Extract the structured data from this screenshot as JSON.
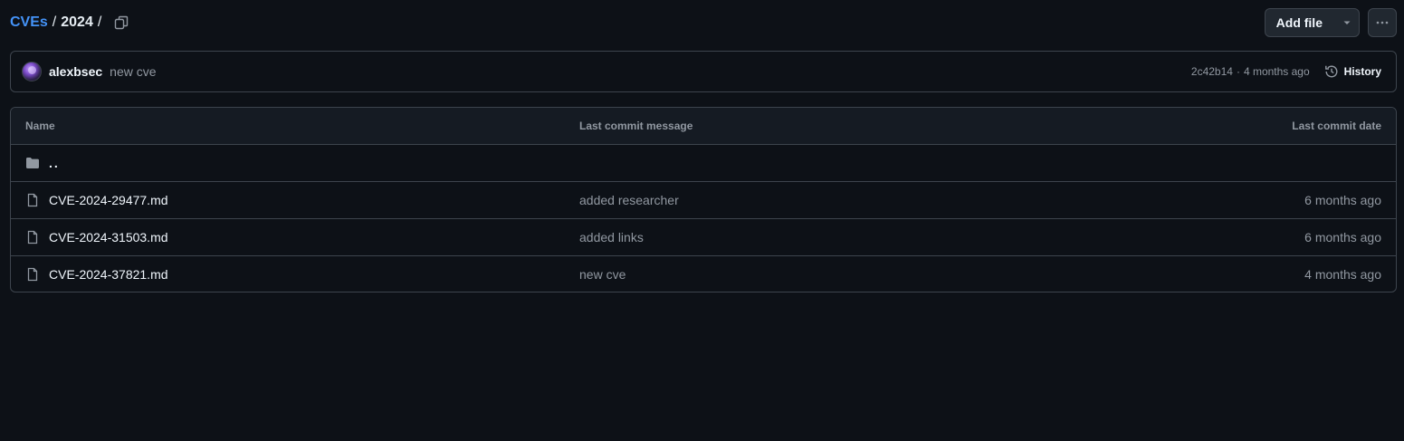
{
  "breadcrumb": {
    "repo": "CVEs",
    "separator": "/",
    "current": "2024",
    "trailing_separator": "/",
    "copy_icon": "copy-icon"
  },
  "actions": {
    "add_file_label": "Add file",
    "add_file_caret_icon": "triangle-down-icon",
    "more_icon": "kebab-horizontal-icon"
  },
  "latest_commit": {
    "author": "alexbsec",
    "message": "new cve",
    "sha": "2c42b14",
    "dot": "·",
    "time": "4 months ago",
    "history_label": "History",
    "history_icon": "history-icon"
  },
  "table": {
    "headers": {
      "name": "Name",
      "message": "Last commit message",
      "date": "Last commit date"
    },
    "parent": {
      "label": "..",
      "icon": "folder-icon"
    },
    "rows": [
      {
        "name": "CVE-2024-29477.md",
        "message": "added researcher",
        "date": "6 months ago",
        "icon": "file-icon"
      },
      {
        "name": "CVE-2024-31503.md",
        "message": "added links",
        "date": "6 months ago",
        "icon": "file-icon"
      },
      {
        "name": "CVE-2024-37821.md",
        "message": "new cve",
        "date": "4 months ago",
        "icon": "file-icon"
      }
    ]
  },
  "colors": {
    "background": "#0d1117",
    "link": "#4493f8",
    "border": "#3d444d",
    "muted_text": "#9198a1",
    "header_bg": "#151b23"
  }
}
